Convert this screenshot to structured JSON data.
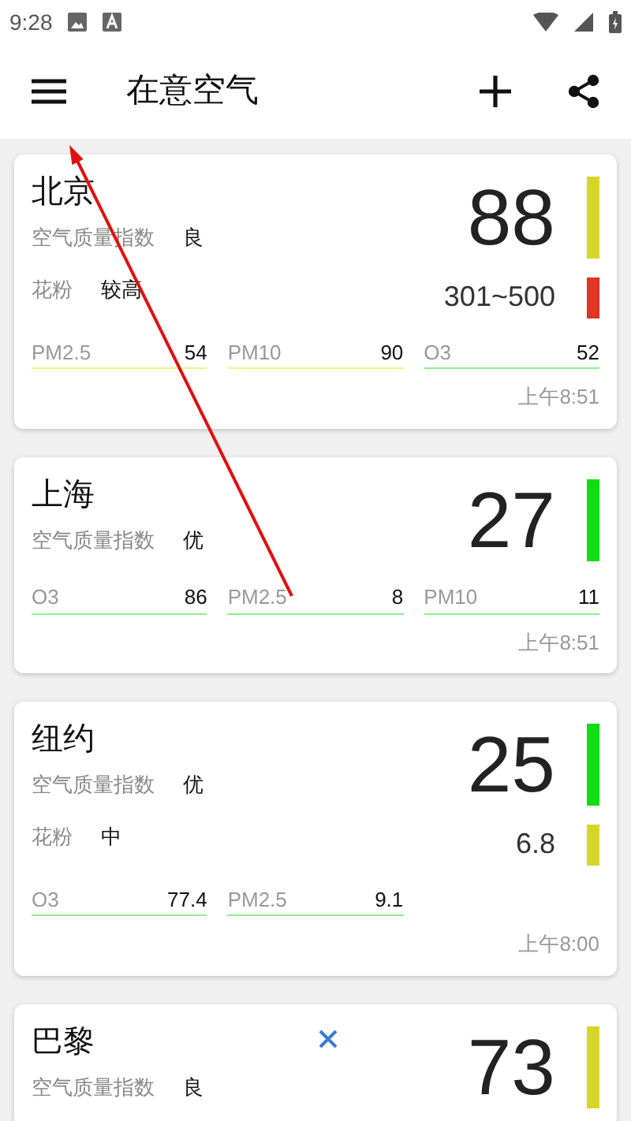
{
  "status_bar": {
    "time": "9:28"
  },
  "app_bar": {
    "title": "在意空气"
  },
  "cities": [
    {
      "name": "北京",
      "aqi_label": "空气质量指数",
      "level": "良",
      "aqi": {
        "value": "88",
        "color": "#d6d62a"
      },
      "pollen": {
        "label": "花粉",
        "level": "较高",
        "value": "301~500",
        "color": "#e03424"
      },
      "pollutants": [
        {
          "name": "PM2.5",
          "value": "54",
          "color": "#f2f28a"
        },
        {
          "name": "PM10",
          "value": "90",
          "color": "#f2f28a"
        },
        {
          "name": "O3",
          "value": "52",
          "color": "#8cf08c"
        }
      ],
      "time": "上午8:51"
    },
    {
      "name": "上海",
      "aqi_label": "空气质量指数",
      "level": "优",
      "aqi": {
        "value": "27",
        "color": "#12dd12"
      },
      "pollutants": [
        {
          "name": "O3",
          "value": "86",
          "color": "#8cf08c"
        },
        {
          "name": "PM2.5",
          "value": "8",
          "color": "#8cf08c"
        },
        {
          "name": "PM10",
          "value": "11",
          "color": "#8cf08c"
        }
      ],
      "time": "上午8:51"
    },
    {
      "name": "纽约",
      "aqi_label": "空气质量指数",
      "level": "优",
      "aqi": {
        "value": "25",
        "color": "#12dd12"
      },
      "pollen": {
        "label": "花粉",
        "level": "中",
        "value": "6.8",
        "color": "#d6d62a"
      },
      "pollutants": [
        {
          "name": "O3",
          "value": "77.4",
          "color": "#8cf08c"
        },
        {
          "name": "PM2.5",
          "value": "9.1",
          "color": "#8cf08c"
        }
      ],
      "time": "上午8:00"
    },
    {
      "name": "巴黎",
      "aqi_label": "空气质量指数",
      "level": "良",
      "aqi": {
        "value": "73",
        "color": "#d6d62a"
      },
      "remove_mark": true
    }
  ]
}
